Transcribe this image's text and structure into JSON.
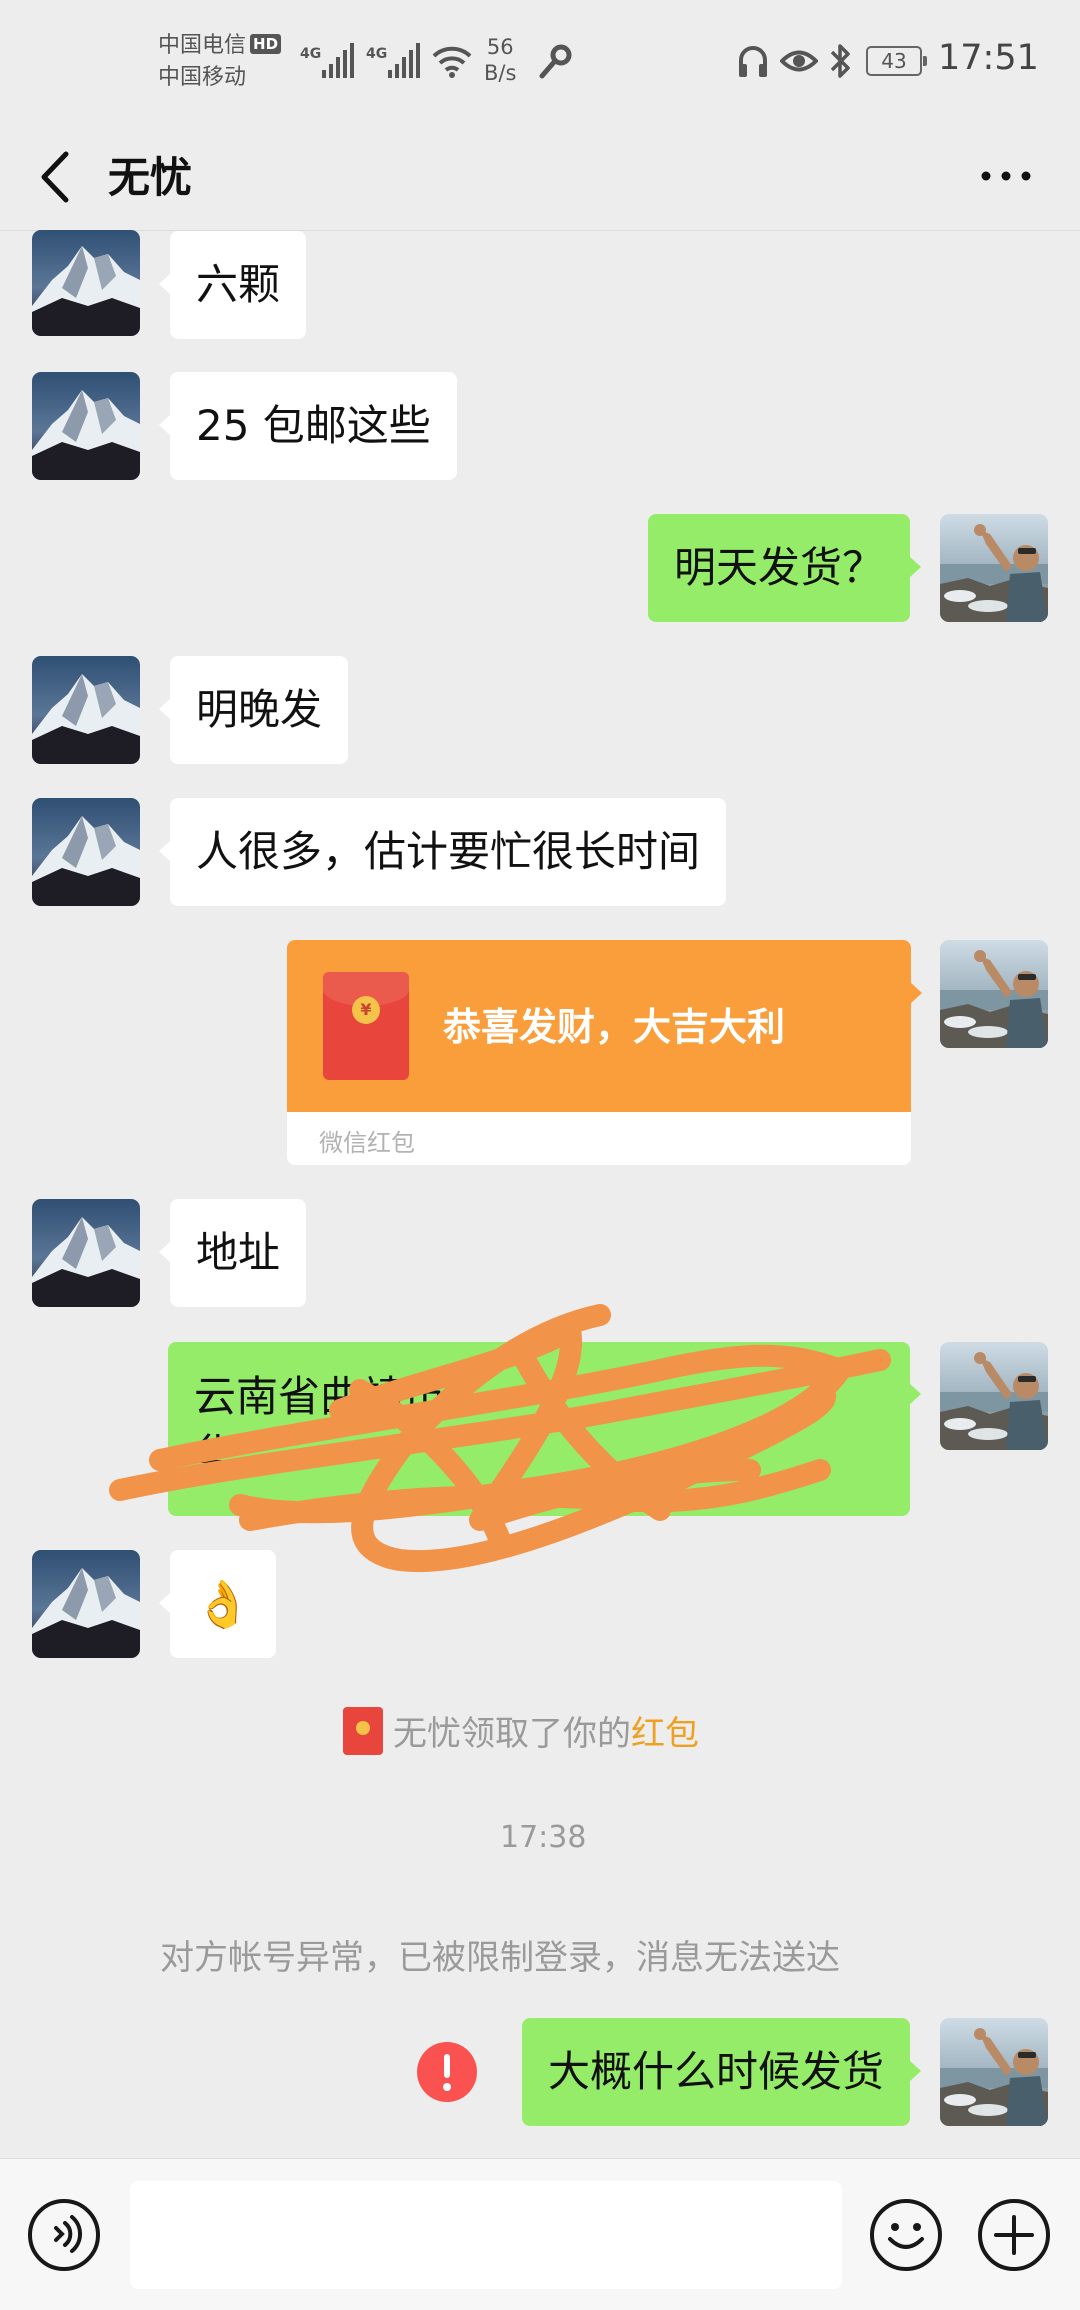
{
  "status_bar": {
    "carrier_1": "中国电信",
    "hd": "HD",
    "carrier_2": "中国移动",
    "net_type_1": "4G",
    "net_type_2": "4G",
    "speed_value": "56",
    "speed_unit": "B/s",
    "battery": "43",
    "time": "17:51"
  },
  "header": {
    "title": "无忧",
    "back_icon": "back-arrow-icon",
    "more_icon": "more-dots-icon"
  },
  "messages": [
    {
      "side": "left",
      "text": "六颗"
    },
    {
      "side": "left",
      "text": "25 包邮这些"
    },
    {
      "side": "right",
      "text": "明天发货？"
    },
    {
      "side": "left",
      "text": "明晚发"
    },
    {
      "side": "left",
      "text": "人很多，估计要忙很长时间"
    },
    {
      "side": "right",
      "type": "red_packet",
      "title": "恭喜发财，大吉大利",
      "label": "微信红包"
    },
    {
      "side": "left",
      "text": "地址"
    },
    {
      "side": "right",
      "text_line_1": "云南省曲靖市",
      "text_line_2": "华",
      "redacted": true
    },
    {
      "side": "left",
      "text": "👌"
    },
    {
      "side": "right",
      "text": "大概什么时候发货",
      "failed": true
    }
  ],
  "system": {
    "claim_prefix": "无忧领取了你的",
    "claim_link": "红包",
    "timestamp": "17:38",
    "restricted_notice": "对方帐号异常，已被限制登录，消息无法送达"
  },
  "input_bar": {
    "voice_icon": "voice-icon",
    "emoji_icon": "emoji-icon",
    "plus_icon": "plus-icon"
  },
  "colors": {
    "chat_bg": "#ededed",
    "bubble_sent": "#95ec69",
    "bubble_received": "#ffffff",
    "red_packet": "#fa9d3b",
    "link": "#f0a020",
    "error": "#fa5151"
  }
}
